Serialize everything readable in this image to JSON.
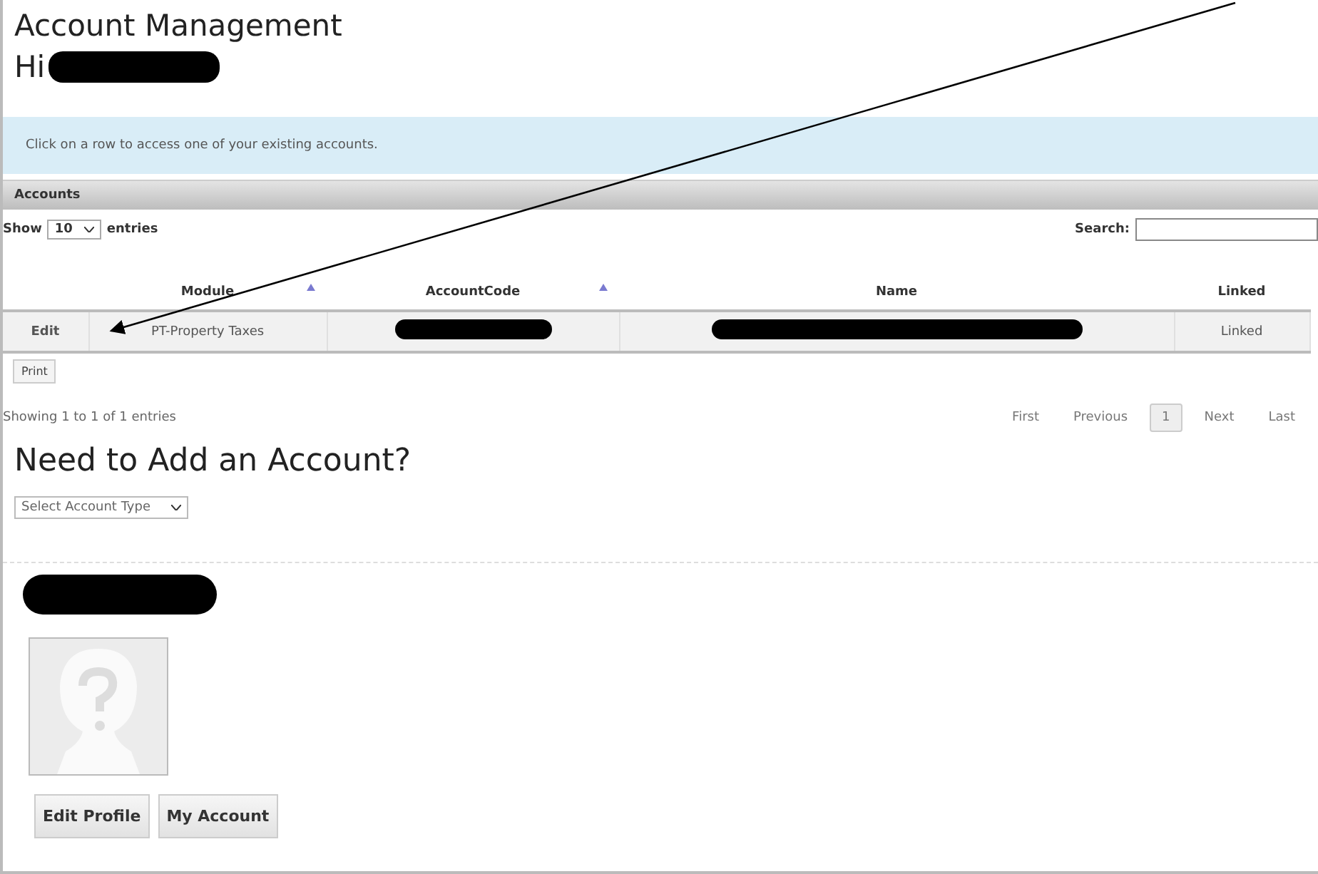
{
  "title": "Account Management",
  "greeting": {
    "text": "Hi",
    "redacted": true
  },
  "info": "Click on a row to access one of your existing accounts.",
  "panel": {
    "title": "Accounts"
  },
  "length_menu": {
    "before": "Show",
    "value": "10",
    "after": "entries"
  },
  "search": {
    "label": "Search:"
  },
  "table": {
    "columns": [
      {
        "sorted": false
      },
      {
        "label": "Module",
        "sorted": true
      },
      {
        "label": "AccountCode",
        "sorted": true
      },
      {
        "label": "Name",
        "sorted": false
      },
      {
        "label": "Linked",
        "sorted": false
      }
    ],
    "rows": [
      [
        {
          "kind": "action",
          "text": "Edit"
        },
        {
          "kind": "text",
          "text": "PT-Property Taxes"
        },
        {
          "kind": "redacted"
        },
        {
          "kind": "redacted"
        },
        {
          "kind": "text",
          "text": "Linked"
        }
      ]
    ]
  },
  "print_button": "Print",
  "info_footer": "Showing 1 to 1 of 1 entries",
  "pagination": [
    {
      "label": "First",
      "selected": false
    },
    {
      "label": "Previous",
      "selected": false
    },
    {
      "label": "1",
      "selected": true
    },
    {
      "label": "Next",
      "selected": false
    },
    {
      "label": "Last",
      "selected": false
    }
  ],
  "add_heading": "Need to Add an Account?",
  "account_type_select": {
    "value": "Select Account Type"
  },
  "profile": {
    "name_redacted": true,
    "buttons": [
      "Edit Profile",
      "My Account"
    ]
  },
  "annotation": {
    "kind": "arrow"
  }
}
